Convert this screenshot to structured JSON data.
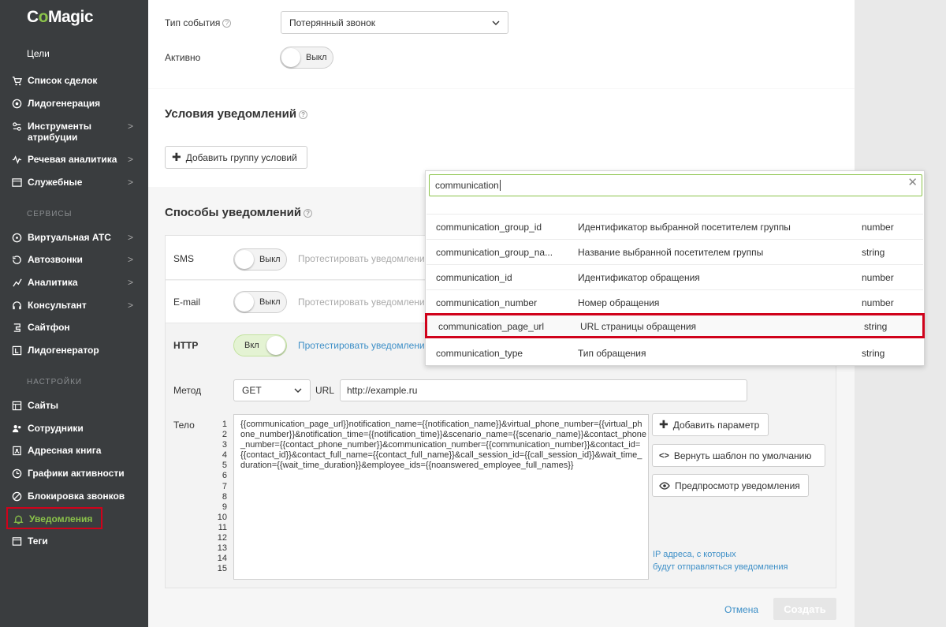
{
  "sidebar": {
    "logo_prefix": "C",
    "logo_o": "o",
    "logo_rest": "Magic",
    "goals_label": "Цели",
    "items": [
      {
        "label": "Список сделок",
        "chev": ""
      },
      {
        "label": "Лидогенерация",
        "chev": ""
      },
      {
        "label": "Инструменты атрибуции",
        "chev": ">"
      },
      {
        "label": "Речевая аналитика",
        "chev": ">"
      },
      {
        "label": "Служебные",
        "chev": ">"
      }
    ],
    "services_head": "СЕРВИСЫ",
    "services": [
      {
        "label": "Виртуальная АТС",
        "chev": ">"
      },
      {
        "label": "Автозвонки",
        "chev": ">"
      },
      {
        "label": "Аналитика",
        "chev": ">"
      },
      {
        "label": "Консультант",
        "chev": ">"
      },
      {
        "label": "Сайтфон",
        "chev": ""
      },
      {
        "label": "Лидогенератор",
        "chev": ""
      }
    ],
    "settings_head": "НАСТРОЙКИ",
    "settings": [
      {
        "label": "Сайты"
      },
      {
        "label": "Сотрудники"
      },
      {
        "label": "Адресная книга"
      },
      {
        "label": "Графики активности"
      },
      {
        "label": "Блокировка звонков"
      },
      {
        "label": "Уведомления"
      },
      {
        "label": "Теги"
      }
    ]
  },
  "form": {
    "event_type_label": "Тип события",
    "event_type_value": "Потерянный звонок",
    "active_label": "Активно",
    "active_toggle": "Выкл",
    "conditions_title": "Условия уведомлений",
    "add_group_button": "Добавить группу условий",
    "methods_title": "Способы уведомлений",
    "sms_label": "SMS",
    "sms_toggle": "Выкл",
    "sms_test": "Протестировать уведомления",
    "email_label": "E-mail",
    "email_toggle": "Выкл",
    "email_test": "Протестировать уведомления",
    "http_label": "HTTP",
    "http_toggle": "Вкл",
    "http_test": "Протестировать уведомления",
    "method_label": "Метод",
    "method_value": "GET",
    "url_label": "URL",
    "url_value": "http://example.ru",
    "body_label": "Тело",
    "line_numbers": [
      "1",
      "2",
      "3",
      "4",
      "5",
      "6",
      "7",
      "8",
      "9",
      "10",
      "11",
      "12",
      "13",
      "14",
      "15"
    ],
    "body_text": "{{communication_page_url}}notification_name={{notification_name}}&virtual_phone_number={{virtual_phone_number}}&notification_time={{notification_time}}&scenario_name={{scenario_name}}&contact_phone_number={{contact_phone_number}}&communication_number={{communication_number}}&contact_id={{contact_id}}&contact_full_name={{contact_full_name}}&call_session_id={{call_session_id}}&wait_time_duration={{wait_time_duration}}&employee_ids={{noanswered_employee_full_names}}",
    "add_param_button": "Добавить параметр",
    "reset_template_button": "Вернуть шаблон по умолчанию",
    "preview_button": "Предпросмотр уведомления",
    "ip_link_line1": "IP адреса, с которых",
    "ip_link_line2": "будут отправляться уведомления",
    "cancel_button": "Отмена",
    "create_button": "Создать"
  },
  "dropdown": {
    "search_value": "communication",
    "rows": [
      {
        "name": "communication_group_id",
        "desc": "Идентификатор выбранной посетителем группы",
        "type": "number"
      },
      {
        "name": "communication_group_na...",
        "desc": "Название выбранной посетителем группы",
        "type": "string"
      },
      {
        "name": "communication_id",
        "desc": "Идентификатор обращения",
        "type": "number"
      },
      {
        "name": "communication_number",
        "desc": "Номер обращения",
        "type": "number"
      },
      {
        "name": "communication_page_url",
        "desc": "URL страницы обращения",
        "type": "string"
      },
      {
        "name": "communication_type",
        "desc": "Тип обращения",
        "type": "string"
      }
    ]
  },
  "colors": {
    "accent": "#8bc34a",
    "highlight": "#d0021b",
    "link": "#3d8fc7",
    "sidebar": "#3a3d3f"
  }
}
